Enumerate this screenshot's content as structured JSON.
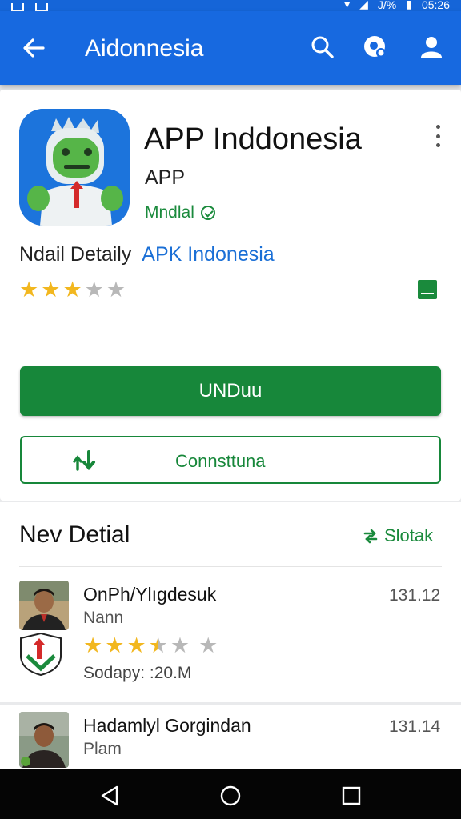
{
  "colors": {
    "appbar": "#1769e0",
    "primary_green": "#17873a",
    "link_blue": "#1a6fd6",
    "star": "#f2b71f"
  },
  "status": {
    "battery": "J/%",
    "time": "05:26"
  },
  "appbar": {
    "title": "Aidonnesia",
    "back_icon": "arrow-left-icon",
    "actions": [
      "search-icon",
      "settings-search-icon",
      "account-icon"
    ]
  },
  "app": {
    "name": "APP Inddonesia",
    "subtitle": "APP",
    "developer": "Mndlal",
    "detail_label": "Ndail Detaily",
    "detail_link": "APK Indonesia",
    "rating": 3,
    "rating_max": 5
  },
  "buttons": {
    "install": "UNDuu",
    "secondary": "Connsttuna"
  },
  "section": {
    "title": "Nev Detial",
    "link": "Slotak"
  },
  "reviews": [
    {
      "name": "OnPh/Ylıgdesuk",
      "sub": "Nann",
      "date": "131.12",
      "rating": 3.5,
      "meta": "Sodapy: :20.M"
    },
    {
      "name": "Hadamlyl Gorgindan",
      "sub": "Plam",
      "date": "131.14"
    }
  ],
  "navbar": [
    "back-triangle-icon",
    "home-circle-icon",
    "recents-square-icon"
  ]
}
